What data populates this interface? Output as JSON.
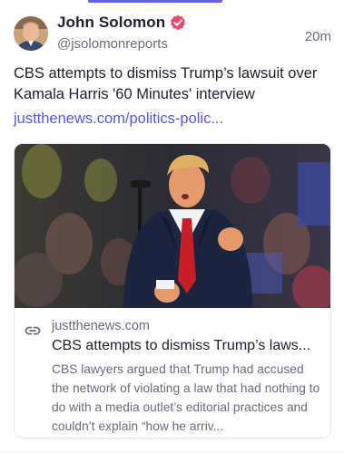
{
  "header": {
    "display_name": "John Solomon",
    "handle": "@jsolomonreports",
    "timestamp": "20m",
    "avatar_icon": "avatar-photo",
    "verified_icon": "verified-badge-icon",
    "verified_color": "#e8486a"
  },
  "post": {
    "text": "CBS attempts to dismiss Trump’s lawsuit over Kamala Harris '60 Minutes' interview",
    "link_text": "justthenews.com/politics-polic..."
  },
  "link_card": {
    "image_alt": "Donald Trump speaking at a rally",
    "link_icon": "link-icon",
    "domain": "justthenews.com",
    "title": "CBS attempts to dismiss Trump’s laws...",
    "description": "CBS lawyers argued that Trump had accused the network of violating a law that had nothing to do with a media outlet’s editorial practices and couldn’t explain “how he arriv..."
  },
  "colors": {
    "accent": "#6460e8",
    "link": "#5a55e6",
    "text": "#1f1f2e",
    "muted": "#6b6b7b"
  }
}
